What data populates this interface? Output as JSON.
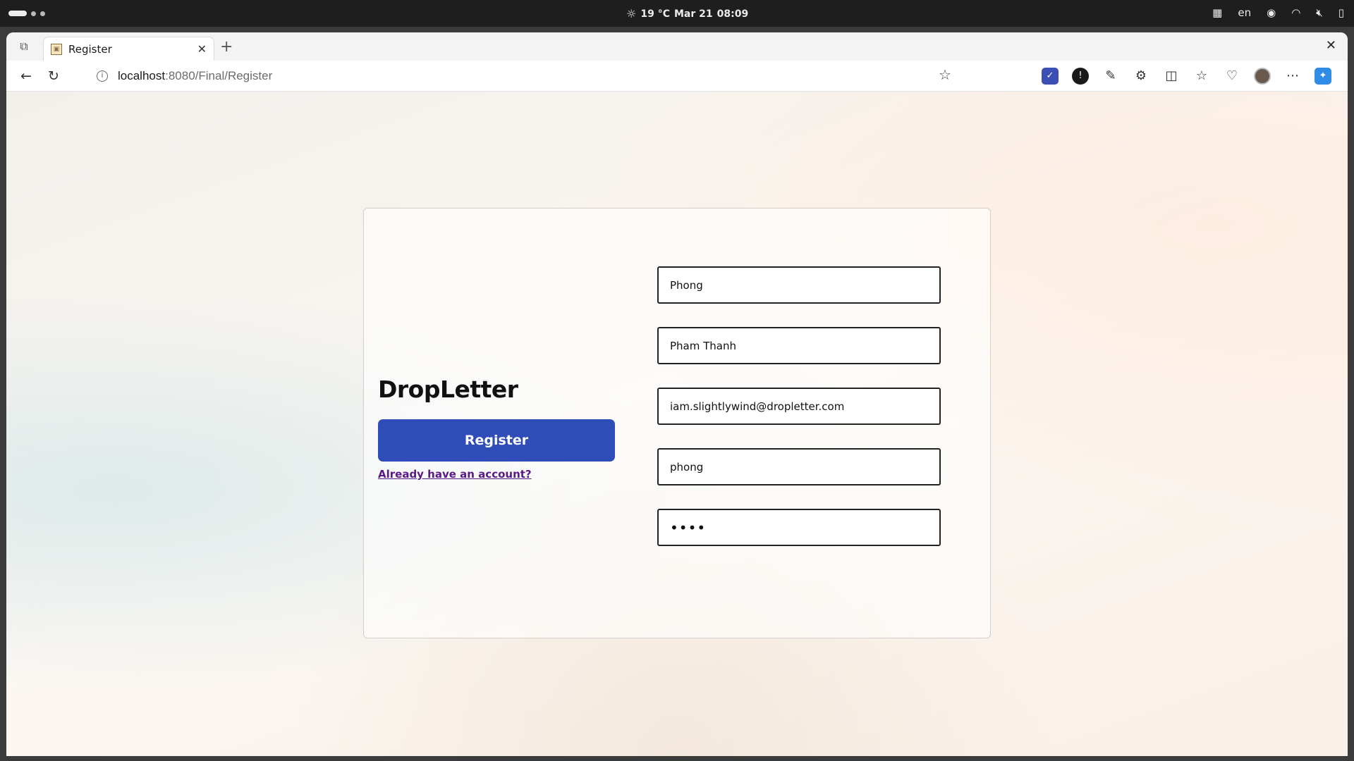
{
  "os_bar": {
    "weather": "19 °C",
    "date": "Mar 21",
    "time": "08:09",
    "language": "en"
  },
  "browser": {
    "tab_title": "Register",
    "url_host": "localhost",
    "url_path": ":8080/Final/Register",
    "icons": [
      "tab-actions-icon",
      "close-icon",
      "plus-icon",
      "back-icon",
      "reload-icon",
      "info-icon",
      "star-icon",
      "extension-icon",
      "split-screen-icon",
      "favorites-icon",
      "more-icon",
      "copilot-icon"
    ]
  },
  "form": {
    "brand": "DropLetter",
    "register_label": "Register",
    "login_link": "Already have an account?",
    "first_name": "Phong",
    "last_name": "Pham Thanh",
    "email": "iam.slightlywind@dropletter.com",
    "username": "phong",
    "password": "••••"
  },
  "colors": {
    "accent": "#2e4db8",
    "link": "#5a1a86"
  }
}
